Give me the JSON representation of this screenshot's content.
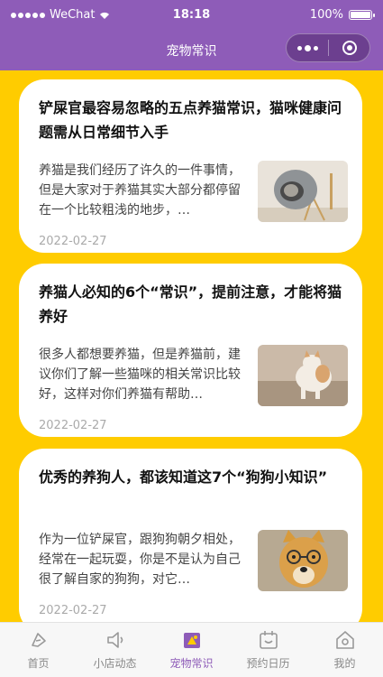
{
  "status_bar": {
    "carrier": "WeChat",
    "time": "18:18",
    "battery": "100%"
  },
  "nav": {
    "title": "宠物常识"
  },
  "articles": [
    {
      "title": "铲屎官最容易忽略的五点养猫常识，猫咪健康问题需从日常细节入手",
      "summary": "养猫是我们经历了许久的一件事情，但是大家对于养猫其实大部分都停留在一个比较粗浅的地步，…",
      "date": "2022-02-27",
      "thumb_icon": "cat-in-pod-photo"
    },
    {
      "title": "养猫人必知的6个“常识”，提前注意，才能将猫养好",
      "summary": "很多人都想要养猫，但是养猫前，建议你们了解一些猫咪的相关常识比较好，这样对你们养猫有帮助…",
      "date": "2022-02-27",
      "thumb_icon": "cat-on-sofa-photo"
    },
    {
      "title": "优秀的养狗人，都该知道这7个“狗狗小知识”",
      "summary": "作为一位铲屎官，跟狗狗朝夕相处，经常在一起玩耍，你是不是认为自己很了解自家的狗狗，对它…",
      "date": "2022-02-27",
      "thumb_icon": "dog-with-glasses-photo"
    }
  ],
  "tabs": [
    {
      "label": "首页",
      "icon": "home-icon",
      "active": false
    },
    {
      "label": "小店动态",
      "icon": "speaker-icon",
      "active": false
    },
    {
      "label": "宠物常识",
      "icon": "pet-knowledge-icon",
      "active": true
    },
    {
      "label": "预约日历",
      "icon": "calendar-icon",
      "active": false
    },
    {
      "label": "我的",
      "icon": "profile-icon",
      "active": false
    }
  ],
  "colors": {
    "header": "#8e5cb8",
    "background": "#ffcc00",
    "active_tab": "#8e5cb8"
  }
}
